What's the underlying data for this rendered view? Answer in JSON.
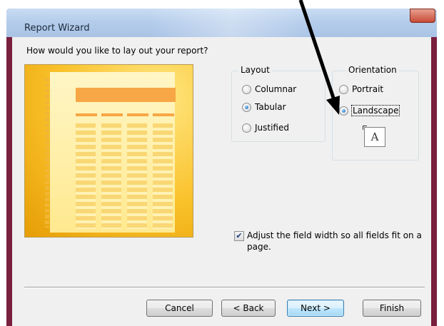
{
  "window": {
    "title": "Report Wizard"
  },
  "question": "How would you like to lay out your report?",
  "layout": {
    "title": "Layout",
    "options": [
      {
        "label": "Columnar",
        "selected": false
      },
      {
        "label": "Tabular",
        "selected": true
      },
      {
        "label": "Justified",
        "selected": false
      }
    ]
  },
  "orientation": {
    "title": "Orientation",
    "options": [
      {
        "label": "Portrait",
        "selected": false
      },
      {
        "label": "Landscape",
        "selected": true
      }
    ],
    "preview_glyph": "A"
  },
  "adjust_checkbox": {
    "checked": true,
    "label": "Adjust the field width so all fields fit on a page."
  },
  "buttons": {
    "cancel": "Cancel",
    "back": "< Back",
    "next": "Next >",
    "finish": "Finish"
  },
  "colors": {
    "preview_orange": "#f9c12a",
    "annotation_arrow": "#000000"
  }
}
